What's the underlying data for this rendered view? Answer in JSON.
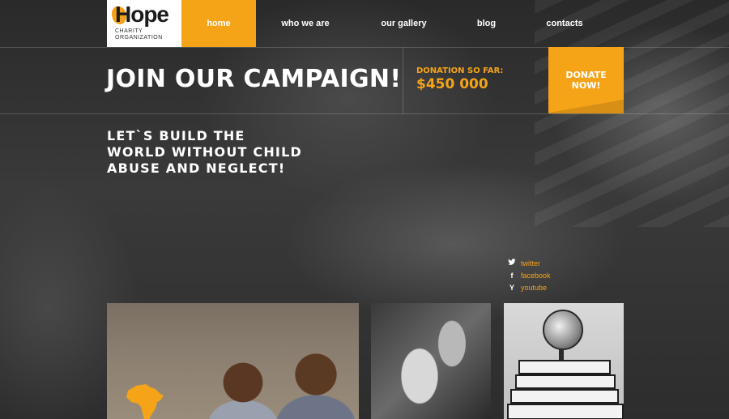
{
  "logo": {
    "word": "Hope",
    "subtitle_line1": "CHARITY",
    "subtitle_line2": "ORGANIZATION"
  },
  "nav": {
    "items": [
      {
        "label": "home",
        "active": true
      },
      {
        "label": "who we are",
        "active": false
      },
      {
        "label": "our gallery",
        "active": false
      },
      {
        "label": "blog",
        "active": false
      },
      {
        "label": "contacts",
        "active": false
      }
    ]
  },
  "campaign": {
    "title": "JOIN OUR CAMPAIGN!",
    "donation_label": "DONATION SO FAR:",
    "donation_amount": "$450 000",
    "donate_line1": "DONATE",
    "donate_line2": "NOW!"
  },
  "slogan": {
    "line1": "LET`S BUILD THE",
    "line2": "WORLD WITHOUT CHILD",
    "line3": "ABUSE AND NEGLECT!"
  },
  "social": [
    {
      "icon": "twitter-icon",
      "label": "twitter"
    },
    {
      "icon": "facebook-icon",
      "label": "facebook"
    },
    {
      "icon": "youtube-icon",
      "label": "youtube"
    }
  ],
  "colors": {
    "accent": "#f5a418",
    "background": "#2c2c2c",
    "logo_bg": "#ffffff"
  }
}
